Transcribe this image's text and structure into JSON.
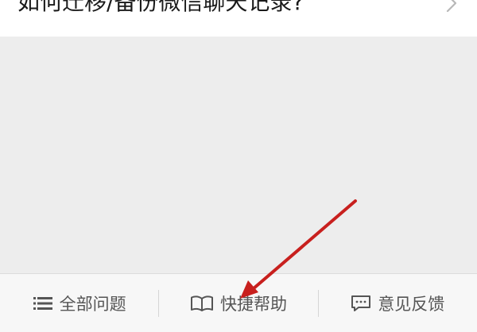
{
  "faq": {
    "question": "如何迁移/备份微信聊天记录?"
  },
  "bottom_bar": {
    "items": [
      {
        "label": "全部问题",
        "icon": "list-icon"
      },
      {
        "label": "快捷帮助",
        "icon": "book-icon"
      },
      {
        "label": "意见反馈",
        "icon": "chat-icon"
      }
    ]
  },
  "colors": {
    "arrow": "#c8201e",
    "text": "#1a1a1a",
    "bar_text": "#555555"
  }
}
